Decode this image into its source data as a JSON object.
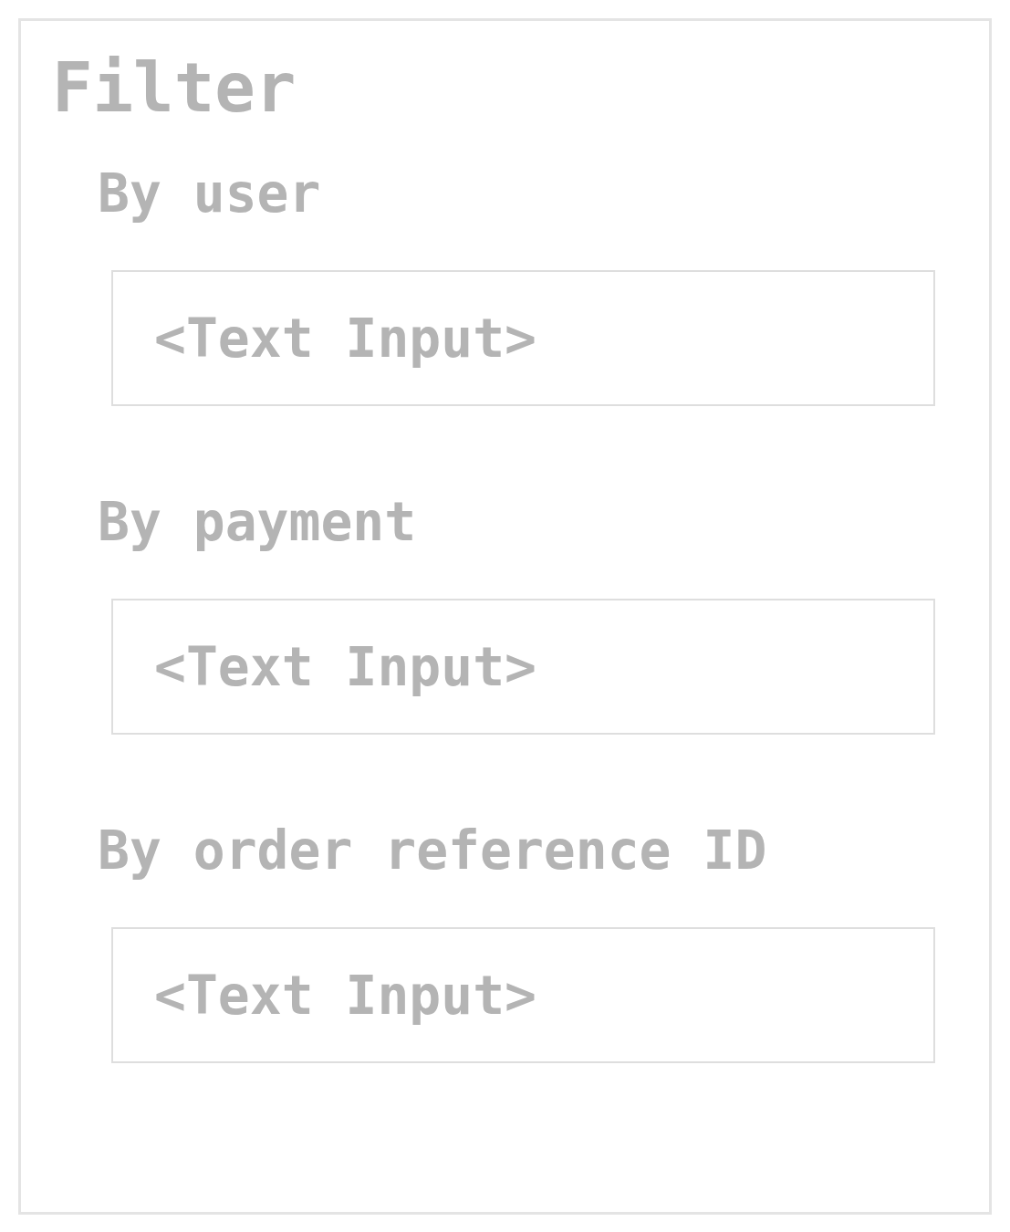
{
  "panel": {
    "title": "Filter",
    "fields": [
      {
        "label": "By user",
        "placeholder": "<Text Input>"
      },
      {
        "label": "By payment",
        "placeholder": "<Text Input>"
      },
      {
        "label": "By order reference ID",
        "placeholder": "<Text Input>"
      }
    ]
  }
}
